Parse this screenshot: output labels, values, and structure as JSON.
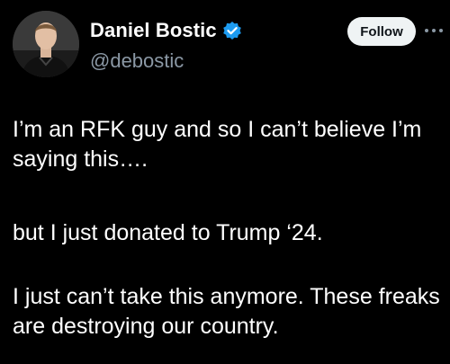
{
  "author": {
    "display_name": "Daniel Bostic",
    "handle": "@debostic",
    "verified": true,
    "avatar_icon": "profile-photo",
    "verified_icon": "verified-badge-icon",
    "verified_color": "#1d9bf0"
  },
  "actions": {
    "follow_label": "Follow",
    "more_icon": "more-dots-icon"
  },
  "post": {
    "paragraphs": [
      "I’m an RFK guy and so I can’t believe I’m saying this….",
      "but I just donated to Trump ‘24.",
      "I just can’t take this anymore. These freaks are destroying our country."
    ]
  },
  "colors": {
    "background": "#000000",
    "text": "#ffffff",
    "secondary_text": "#8b98a5",
    "follow_bg": "#eff3f4"
  }
}
